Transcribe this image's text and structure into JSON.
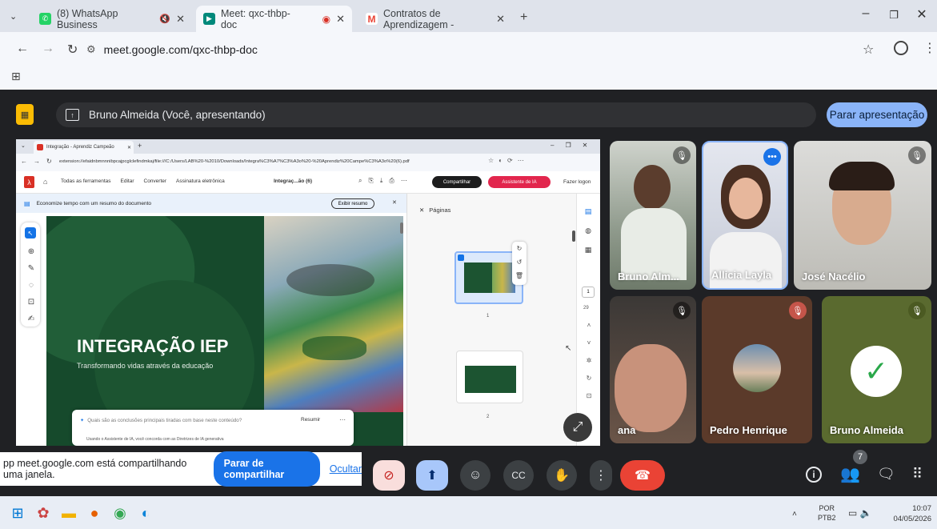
{
  "browser": {
    "tabs": [
      {
        "title": "(8) WhatsApp Business",
        "color": "#25d366"
      },
      {
        "title": "Meet: qxc-thbp-doc",
        "color": "#00897b"
      },
      {
        "title": "Contratos de Aprendizagem - ",
        "color": "#ea4335"
      }
    ],
    "url": "meet.google.com/qxc-thbp-doc"
  },
  "meet": {
    "presenter_text": "Bruno Almeida (Você, apresentando)",
    "stop_label": "Parar apresentação",
    "participants": [
      {
        "name": "Bruno Alm...",
        "muted": true
      },
      {
        "name": "Allicia Layla",
        "muted": false,
        "speaking": true
      },
      {
        "name": "José Nacélio",
        "muted": true
      },
      {
        "name": "ana",
        "muted": true
      },
      {
        "name": "Pedro Henrique",
        "muted": true
      },
      {
        "name": "Bruno Almeida",
        "muted": true
      }
    ],
    "people_count": "7"
  },
  "shared_window": {
    "tab_title": "Integração - Aprendiz Campeão",
    "url": "extension://efaidnbmnnnibpcajpcglclefindmkaj/file:///C:/Users/LAB%20-%2010/Downloads/Integra%C3%A7%C3%A3o%20-%20Aprendiz%20Campe%C3%A3o%20(6).pdf",
    "toolbar": {
      "all_tools": "Todas as ferramentas",
      "edit": "Editar",
      "convert": "Converter",
      "sign": "Assinatura eletrônica",
      "filename": "Integraç...ão (6)",
      "share": "Compartilhar",
      "ai": "Assistente de IA",
      "login": "Fazer logon"
    },
    "summary_banner": "Economize tempo com um resumo do documento",
    "summary_btn": "Exibir resumo",
    "pages_title": "Páginas",
    "slide_title": "INTEGRAÇÃO IEP",
    "slide_subtitle": "Transformando vidas através da educação",
    "page1": "1",
    "page2": "2",
    "page_num": "1",
    "page_total": "29",
    "ai_placeholder": "Quais são as conclusões principais tiradas com base neste conteúdo?",
    "summarize": "Resumir",
    "ai_footer": "Usando o Assistente de IA, você concorda com as Diretrizes de IA generativa"
  },
  "share_notice": {
    "text": "pp meet.google.com está compartilhando uma janela.",
    "stop": "Parar de compartilhar",
    "hide": "Ocultar"
  },
  "taskbar": {
    "lang1": "POR",
    "lang2": "PTB2",
    "time": "10:07",
    "date": "04/05/2026"
  }
}
